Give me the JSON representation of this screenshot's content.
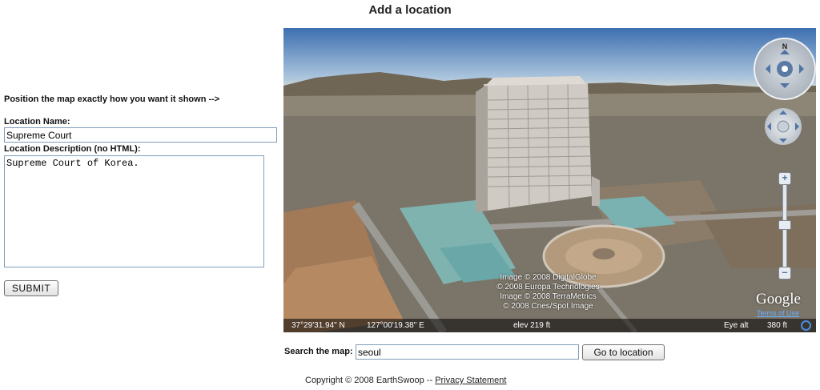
{
  "page": {
    "title": "Add a location"
  },
  "form": {
    "hint": "Position the map exactly how you want it shown -->",
    "name_label": "Location Name:",
    "name_value": "Supreme Court",
    "desc_label": "Location Description (no HTML):",
    "desc_value": "Supreme Court of Korea.",
    "submit_label": "SUBMIT"
  },
  "map": {
    "credits": [
      "Image © 2008 DigitalGlobe",
      "© 2008 Europa Technologies",
      "Image © 2008 TerraMetrics",
      "© 2008 Cnes/Spot Image"
    ],
    "lat": "37°29'31.94\" N",
    "lon": "127°00'19.38\" E",
    "elev": "elev  219 ft",
    "eye_alt_label": "Eye alt",
    "eye_alt_value": "380 ft",
    "brand": "Google",
    "terms": "Terms of Use",
    "compass_letter": "N"
  },
  "search": {
    "label": "Search the map:",
    "value": "seoul",
    "button": "Go to location"
  },
  "footer": {
    "copyright": "Copyright © 2008 EarthSwoop -- ",
    "privacy": "Privacy Statement"
  }
}
